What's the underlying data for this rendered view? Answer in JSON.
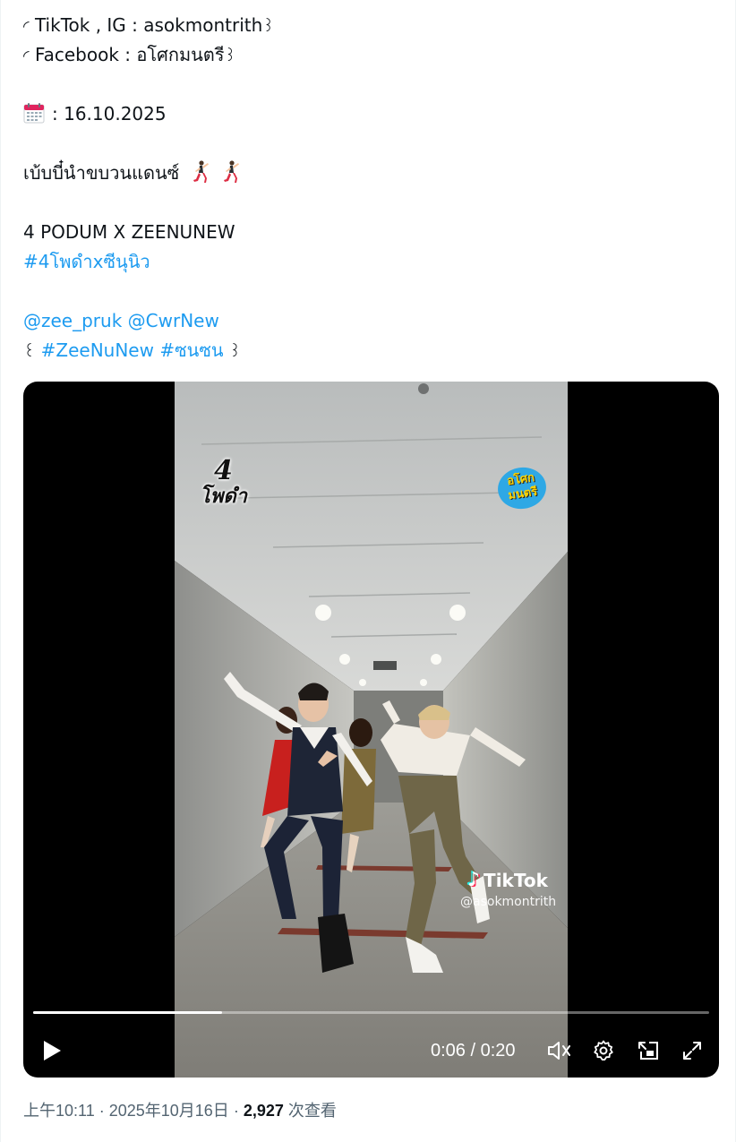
{
  "tweet": {
    "line1_prefix": "◜",
    "line1_text": "TikTok , IG : asokmontrith",
    "line1_suffix": "꒱",
    "line2_prefix": "◜",
    "line2_text": "Facebook : อโศกมนตรี",
    "line2_suffix": "꒱",
    "date_icon": "calendar-icon",
    "date_text": ": 16.10.2025",
    "caption": "เบ้บบี๋นำขบวนแดนซ์",
    "caption_icons": [
      "dancing-man-icon",
      "dancing-man-icon"
    ],
    "title": "4 PODUM X ZEENUNEW",
    "hashtag1": "#4โพดำxซีนุนิว",
    "mention1": "@zee_pruk",
    "mention2": "@CwrNew",
    "tags_prefix": "꒰",
    "hashtag2": "#ZeeNuNew",
    "hashtag3": "#ซนซน",
    "tags_suffix": "꒱"
  },
  "video": {
    "watermark_left_num": "4",
    "watermark_left_text": "โพดำ",
    "watermark_right_line1": "อโศก",
    "watermark_right_line2": "มนตรี",
    "tiktok_brand": "TikTok",
    "tiktok_handle": "@asokmontrith",
    "current_time": "0:06",
    "separator": " / ",
    "duration": "0:20",
    "progress": 0.28,
    "icons": {
      "play": "play-icon",
      "volume": "volume-icon",
      "settings": "settings-gear-icon",
      "pip": "picture-in-picture-icon",
      "fullscreen": "fullscreen-icon"
    }
  },
  "meta": {
    "time": "上午10:11",
    "sep1": " · ",
    "date": "2025年10月16日",
    "sep2": " · ",
    "views_count": "2,927",
    "views_label": " 次查看"
  },
  "colors": {
    "link": "#1d9bf0",
    "text": "#0f1419",
    "secondary": "#536471",
    "video_bg": "#000000"
  }
}
